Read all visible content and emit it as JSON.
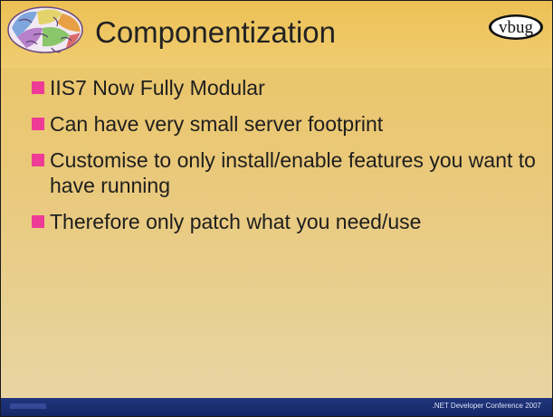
{
  "slide": {
    "title": "Componentization",
    "logo_text": "vbug",
    "bullets": [
      "IIS7 Now Fully Modular",
      "Can have very small server footprint",
      "Customise to only install/enable features you want to have running",
      "Therefore only patch what you need/use"
    ],
    "footer_text": ".NET Developer Conference 2007"
  },
  "icons": {
    "header_image": "brain-icon",
    "logo": "vbug-logo",
    "bullet_marker": "square-bullet"
  },
  "colors": {
    "background": "#ebc462",
    "bullet_marker": "#ee3c96",
    "footer": "#1c2f73",
    "title_text": "#222222"
  }
}
